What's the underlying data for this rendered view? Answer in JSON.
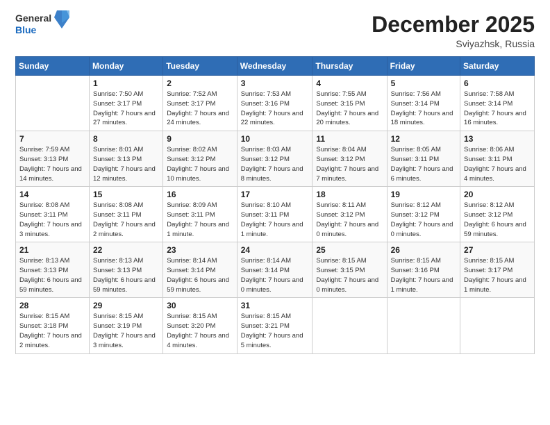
{
  "logo": {
    "general": "General",
    "blue": "Blue"
  },
  "title": "December 2025",
  "subtitle": "Sviyazhsk, Russia",
  "days_header": [
    "Sunday",
    "Monday",
    "Tuesday",
    "Wednesday",
    "Thursday",
    "Friday",
    "Saturday"
  ],
  "weeks": [
    [
      {
        "day": "",
        "sunrise": "",
        "sunset": "",
        "daylight": ""
      },
      {
        "day": "1",
        "sunrise": "Sunrise: 7:50 AM",
        "sunset": "Sunset: 3:17 PM",
        "daylight": "Daylight: 7 hours and 27 minutes."
      },
      {
        "day": "2",
        "sunrise": "Sunrise: 7:52 AM",
        "sunset": "Sunset: 3:17 PM",
        "daylight": "Daylight: 7 hours and 24 minutes."
      },
      {
        "day": "3",
        "sunrise": "Sunrise: 7:53 AM",
        "sunset": "Sunset: 3:16 PM",
        "daylight": "Daylight: 7 hours and 22 minutes."
      },
      {
        "day": "4",
        "sunrise": "Sunrise: 7:55 AM",
        "sunset": "Sunset: 3:15 PM",
        "daylight": "Daylight: 7 hours and 20 minutes."
      },
      {
        "day": "5",
        "sunrise": "Sunrise: 7:56 AM",
        "sunset": "Sunset: 3:14 PM",
        "daylight": "Daylight: 7 hours and 18 minutes."
      },
      {
        "day": "6",
        "sunrise": "Sunrise: 7:58 AM",
        "sunset": "Sunset: 3:14 PM",
        "daylight": "Daylight: 7 hours and 16 minutes."
      }
    ],
    [
      {
        "day": "7",
        "sunrise": "Sunrise: 7:59 AM",
        "sunset": "Sunset: 3:13 PM",
        "daylight": "Daylight: 7 hours and 14 minutes."
      },
      {
        "day": "8",
        "sunrise": "Sunrise: 8:01 AM",
        "sunset": "Sunset: 3:13 PM",
        "daylight": "Daylight: 7 hours and 12 minutes."
      },
      {
        "day": "9",
        "sunrise": "Sunrise: 8:02 AM",
        "sunset": "Sunset: 3:12 PM",
        "daylight": "Daylight: 7 hours and 10 minutes."
      },
      {
        "day": "10",
        "sunrise": "Sunrise: 8:03 AM",
        "sunset": "Sunset: 3:12 PM",
        "daylight": "Daylight: 7 hours and 8 minutes."
      },
      {
        "day": "11",
        "sunrise": "Sunrise: 8:04 AM",
        "sunset": "Sunset: 3:12 PM",
        "daylight": "Daylight: 7 hours and 7 minutes."
      },
      {
        "day": "12",
        "sunrise": "Sunrise: 8:05 AM",
        "sunset": "Sunset: 3:11 PM",
        "daylight": "Daylight: 7 hours and 6 minutes."
      },
      {
        "day": "13",
        "sunrise": "Sunrise: 8:06 AM",
        "sunset": "Sunset: 3:11 PM",
        "daylight": "Daylight: 7 hours and 4 minutes."
      }
    ],
    [
      {
        "day": "14",
        "sunrise": "Sunrise: 8:08 AM",
        "sunset": "Sunset: 3:11 PM",
        "daylight": "Daylight: 7 hours and 3 minutes."
      },
      {
        "day": "15",
        "sunrise": "Sunrise: 8:08 AM",
        "sunset": "Sunset: 3:11 PM",
        "daylight": "Daylight: 7 hours and 2 minutes."
      },
      {
        "day": "16",
        "sunrise": "Sunrise: 8:09 AM",
        "sunset": "Sunset: 3:11 PM",
        "daylight": "Daylight: 7 hours and 1 minute."
      },
      {
        "day": "17",
        "sunrise": "Sunrise: 8:10 AM",
        "sunset": "Sunset: 3:11 PM",
        "daylight": "Daylight: 7 hours and 1 minute."
      },
      {
        "day": "18",
        "sunrise": "Sunrise: 8:11 AM",
        "sunset": "Sunset: 3:12 PM",
        "daylight": "Daylight: 7 hours and 0 minutes."
      },
      {
        "day": "19",
        "sunrise": "Sunrise: 8:12 AM",
        "sunset": "Sunset: 3:12 PM",
        "daylight": "Daylight: 7 hours and 0 minutes."
      },
      {
        "day": "20",
        "sunrise": "Sunrise: 8:12 AM",
        "sunset": "Sunset: 3:12 PM",
        "daylight": "Daylight: 6 hours and 59 minutes."
      }
    ],
    [
      {
        "day": "21",
        "sunrise": "Sunrise: 8:13 AM",
        "sunset": "Sunset: 3:13 PM",
        "daylight": "Daylight: 6 hours and 59 minutes."
      },
      {
        "day": "22",
        "sunrise": "Sunrise: 8:13 AM",
        "sunset": "Sunset: 3:13 PM",
        "daylight": "Daylight: 6 hours and 59 minutes."
      },
      {
        "day": "23",
        "sunrise": "Sunrise: 8:14 AM",
        "sunset": "Sunset: 3:14 PM",
        "daylight": "Daylight: 6 hours and 59 minutes."
      },
      {
        "day": "24",
        "sunrise": "Sunrise: 8:14 AM",
        "sunset": "Sunset: 3:14 PM",
        "daylight": "Daylight: 7 hours and 0 minutes."
      },
      {
        "day": "25",
        "sunrise": "Sunrise: 8:15 AM",
        "sunset": "Sunset: 3:15 PM",
        "daylight": "Daylight: 7 hours and 0 minutes."
      },
      {
        "day": "26",
        "sunrise": "Sunrise: 8:15 AM",
        "sunset": "Sunset: 3:16 PM",
        "daylight": "Daylight: 7 hours and 1 minute."
      },
      {
        "day": "27",
        "sunrise": "Sunrise: 8:15 AM",
        "sunset": "Sunset: 3:17 PM",
        "daylight": "Daylight: 7 hours and 1 minute."
      }
    ],
    [
      {
        "day": "28",
        "sunrise": "Sunrise: 8:15 AM",
        "sunset": "Sunset: 3:18 PM",
        "daylight": "Daylight: 7 hours and 2 minutes."
      },
      {
        "day": "29",
        "sunrise": "Sunrise: 8:15 AM",
        "sunset": "Sunset: 3:19 PM",
        "daylight": "Daylight: 7 hours and 3 minutes."
      },
      {
        "day": "30",
        "sunrise": "Sunrise: 8:15 AM",
        "sunset": "Sunset: 3:20 PM",
        "daylight": "Daylight: 7 hours and 4 minutes."
      },
      {
        "day": "31",
        "sunrise": "Sunrise: 8:15 AM",
        "sunset": "Sunset: 3:21 PM",
        "daylight": "Daylight: 7 hours and 5 minutes."
      },
      {
        "day": "",
        "sunrise": "",
        "sunset": "",
        "daylight": ""
      },
      {
        "day": "",
        "sunrise": "",
        "sunset": "",
        "daylight": ""
      },
      {
        "day": "",
        "sunrise": "",
        "sunset": "",
        "daylight": ""
      }
    ]
  ]
}
